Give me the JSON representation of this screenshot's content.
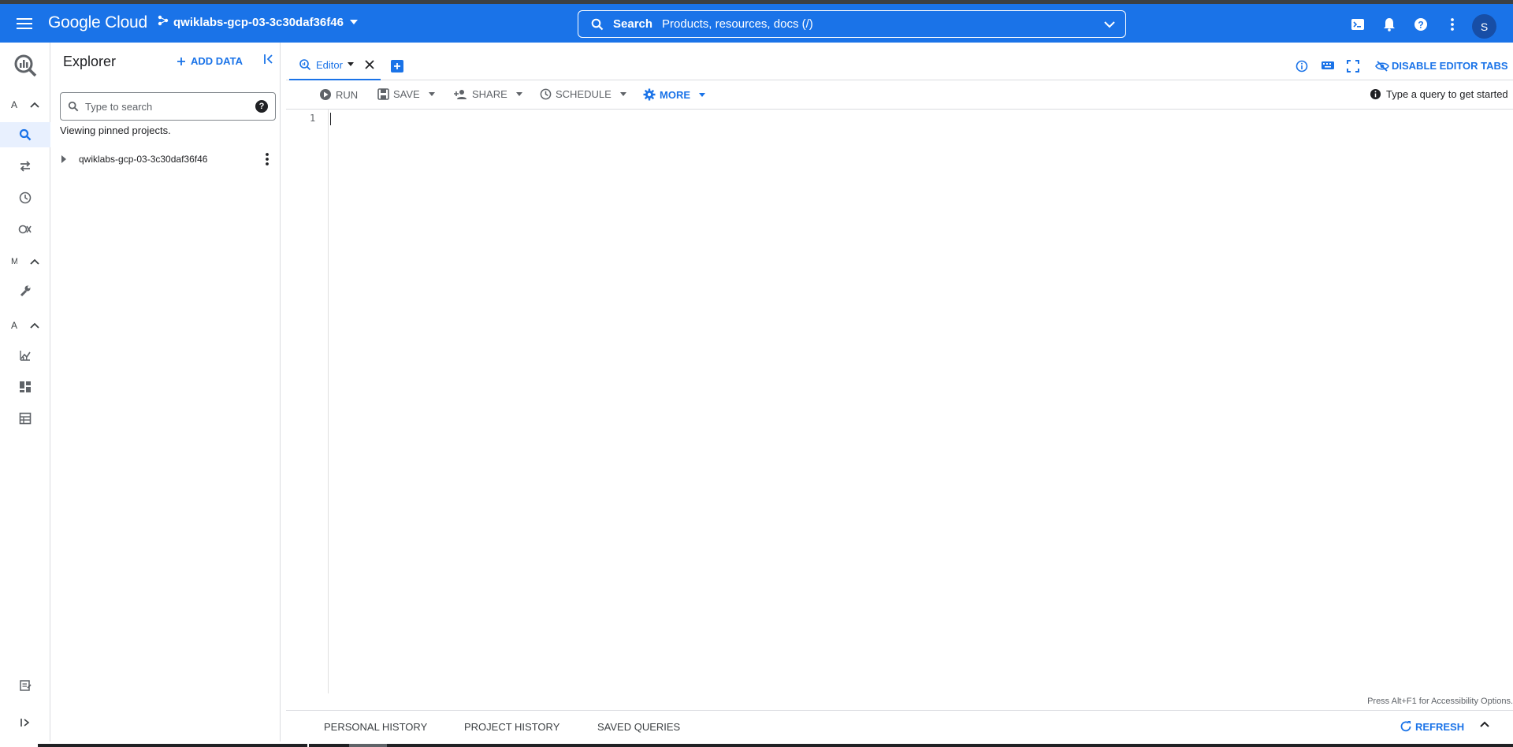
{
  "header": {
    "logo": "Google Cloud",
    "project": "qwiklabs-gcp-03-3c30daf36f46",
    "search_label": "Search",
    "search_placeholder": "Products, resources, docs (/)",
    "avatar_letter": "S"
  },
  "rail": {
    "sections": [
      {
        "letter": "A"
      },
      {
        "letter": "M"
      },
      {
        "letter": "A"
      }
    ]
  },
  "explorer": {
    "title": "Explorer",
    "add_data": "ADD DATA",
    "search_placeholder": "Type to search",
    "viewing": "Viewing pinned projects.",
    "project": "qwiklabs-gcp-03-3c30daf36f46"
  },
  "tabs": {
    "editor_label": "Editor",
    "disable_tabs": "DISABLE EDITOR TABS"
  },
  "toolbar": {
    "run": "RUN",
    "save": "SAVE",
    "share": "SHARE",
    "schedule": "SCHEDULE",
    "more": "MORE",
    "hint": "Type a query to get started"
  },
  "editor": {
    "line_number": "1",
    "a11y_hint": "Press Alt+F1 for Accessibility Options."
  },
  "bottom": {
    "personal_history": "PERSONAL HISTORY",
    "project_history": "PROJECT HISTORY",
    "saved_queries": "SAVED QUERIES",
    "refresh": "REFRESH"
  },
  "colors": {
    "brand": "#1a73e8",
    "avatar": "#174ea6"
  }
}
